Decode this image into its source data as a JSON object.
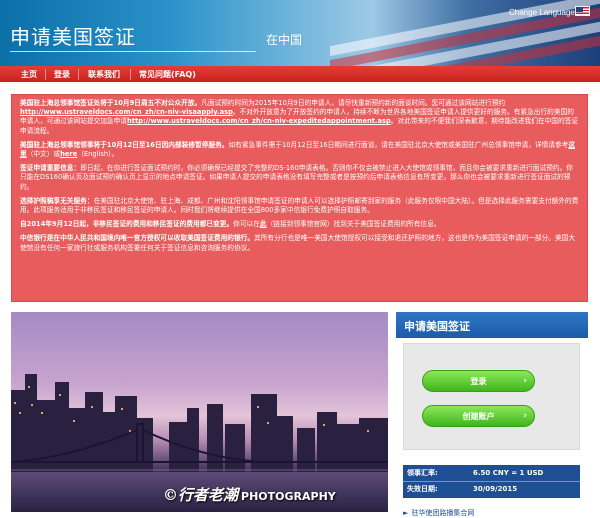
{
  "header": {
    "site_title": "申请美国签证",
    "country": "在中国",
    "change_language": "Change Language:"
  },
  "nav": {
    "items": [
      "主页",
      "登录",
      "联系我们",
      "常见问题(FAQ)"
    ]
  },
  "alert": {
    "p1": {
      "bold": "美国驻上海总领事馆签证处将于10月9日周五不对公众开放。",
      "text1": "凡面试预约时间为2015年10月9日的申请人，请尽快重新预约新的面谈时间。您可通过该网站进行预约",
      "link1": "http://www.ustraveldocs.com/cn_zh/cn-niv-visaapply.asp",
      "text2": "。不对外开放意为了开放签约的申请人，持续不断为世界各地美国签证申请人提供更好的服务。有紧急出行的美国的申请人，可通过该网站提交加急申请",
      "link2": "http://www.ustraveldocs.com/cn_zh/cn-niv-expeditedappointment.asp",
      "text3": "。对此带来的不便我们深表歉意，期待能改进我们在中国的签证申请流程。"
    },
    "p2": {
      "bold": "美国驻上海总领事馆领事将于10月12日至16日因内部装修暂停服务。",
      "text1": "如有紧急事件需于10月12日至16日期间进行面谈，请在美国驻北京大使馆或美国驻广州总领事馆申请，详情请参考",
      "link1": "这里",
      "text2": "（中文）或",
      "link2": "here",
      "text3": "（English）。"
    },
    "p3": {
      "bold": "签证申请重要信息：",
      "text": "即日起，在你进行签证面试预约时，你必须确保已经提交了完整的DS-160申请表格。否则你不仅会被禁止进入大使馆或领事馆，而且你会被要求重新进行面试预约。你只能在DS160确认页及面试预约确认页上显示的地点申请签证。如果申请人提交的申请表格没有填写完整或者是按预约后申请表格信息有所变更，那么你也会被要求重新进行签证面试的预约。"
    },
    "p4": {
      "bold": "选择护照稿享无关服务：",
      "text": "在美国驻北京大使馆、驻上海、成都、广州和沈阳领事馆申请签证的申请人可以选择护照邮寄到家的服务（此服务仅限中国大陆）。但是选择此服务需要支付额外的费用。此项服务适用于非移民签证和移民签证的申请人。同时我们将继续提供在全国800多家中信银行免费护照自取服务。"
    },
    "p5": {
      "bold": "自2014年9月12日起，非移民签证的费用和移民签证的费用都已变更。",
      "text1": "你可以在",
      "link1": "此",
      "text2": "（链接到领事馆官网）找到关于美国签证费用的所有信息。"
    },
    "p6": {
      "bold": "中信银行是在中华人民共和国境内唯一官方授权可以收取美国签证费用的银行。",
      "text": "其所有分行也是唯一美国大使馆授权可以接受和退还护照的地方，这也是作为美国签证申请的一部分。美国大使馆没有任何一家旅行社或服务机构签署任何关于签证信息和咨询服务的协议。"
    }
  },
  "photo": {
    "watermark_cn": "©行者老潮",
    "watermark_en": "PHOTOGRAPHY"
  },
  "panel": {
    "title": "申请美国签证",
    "login_label": "登录",
    "create_account_label": "创建账户",
    "arrow": "›"
  },
  "info": {
    "rate_label": "领事汇率:",
    "rate_value": "6.50 CNY = 1 USD",
    "expiry_label": "失效日期:",
    "expiry_value": "30/09/2015"
  },
  "link": {
    "embassy": "驻华使团路播集合网"
  },
  "colors": {
    "nav_red": "#d32b25",
    "alert_red": "#e85c5d",
    "panel_blue": "#1e4e93",
    "button_green": "#3fb51c"
  }
}
